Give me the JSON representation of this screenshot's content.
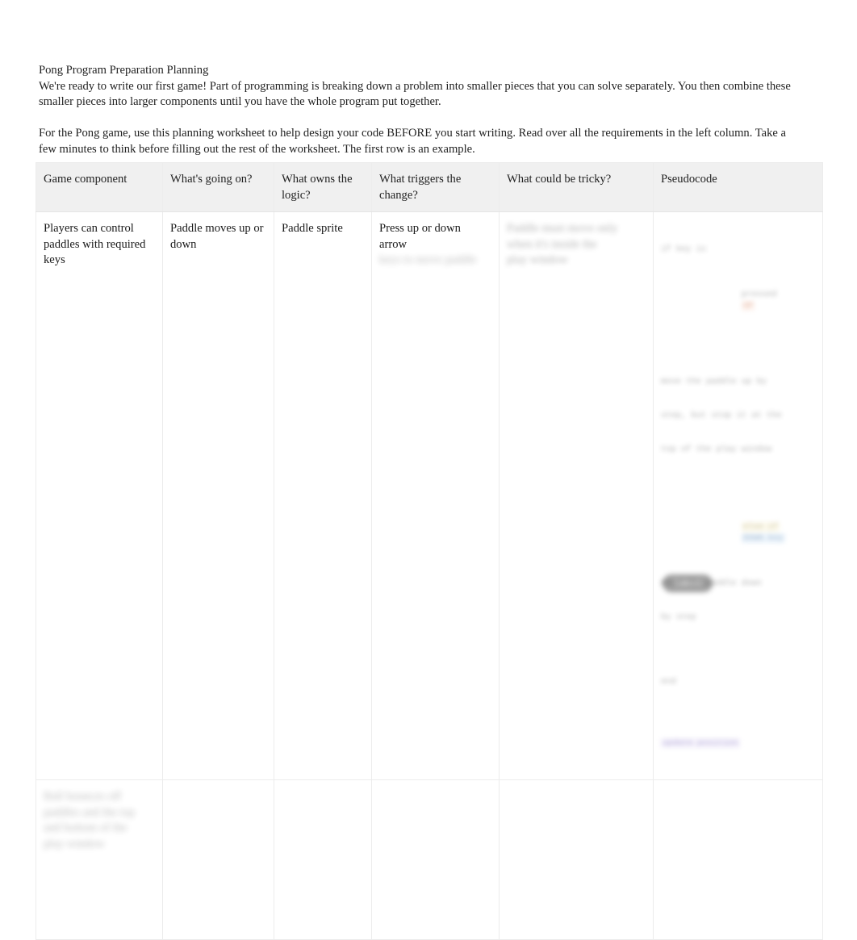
{
  "document": {
    "title": "Pong Program Preparation Planning",
    "intro_paragraph_1": "We're ready to write our first game! Part of programming is breaking down a problem into smaller pieces that you can solve separately. You then combine these smaller pieces into larger components until you have the whole program put together.",
    "intro_paragraph_2": "For the Pong game, use this planning worksheet to help design your code BEFORE you start writing. Read over all the requirements in the left column. Take a few minutes to think before filling out the rest of the worksheet. The first row is an example."
  },
  "table": {
    "headers": [
      "Game component",
      "What's going on?",
      "What owns the logic?",
      "What triggers the change?",
      "What could be tricky?",
      "Pseudocode"
    ],
    "rows": [
      {
        "kind": "example",
        "game_component": "Players can control paddles with required keys",
        "whats_going_on": "Paddle moves up or down",
        "owns_logic": "Paddle sprite",
        "triggers_change_line1": "Press up or down",
        "triggers_change_line2": "arrow",
        "triggers_change_line3": "keys to move paddle",
        "could_be_tricky_line1": "Paddle must move only",
        "could_be_tricky_line2": "when it's inside the",
        "could_be_tricky_line3": "play window",
        "pseudocode_line1": "if key is",
        "pseudocode_line2": "pressed",
        "pseudocode_keyword": "UP",
        "pseudocode_line3": "move the paddle up by",
        "pseudocode_line4": "step, but stop it at the",
        "pseudocode_line5": "top of the play window",
        "pseudocode_line6": "else if",
        "pseudocode_keyword2": "DOWN key",
        "pseudocode_line7": "move the paddle down",
        "pseudocode_line8": "by step",
        "pseudocode_line9": "end",
        "pseudocode_keyword3": "update position"
      },
      {
        "kind": "blank",
        "game_component_line1": "Ball bounces off",
        "game_component_line2": "paddles and the top",
        "game_component_line3": "and bottom of the",
        "game_component_line4": "play window",
        "whats_going_on": "",
        "owns_logic": "",
        "triggers_change": "",
        "could_be_tricky": "",
        "pseudocode": ""
      }
    ]
  },
  "footer": {
    "action_label": "Submit"
  },
  "colors": {
    "header_background": "#f0f0f0",
    "border": "#ececec",
    "text": "#222222",
    "button_background": "#3d3d3d",
    "accent_rose": "#c0603a",
    "accent_blue": "#35618e",
    "accent_lavender": "#5d4aa8"
  }
}
